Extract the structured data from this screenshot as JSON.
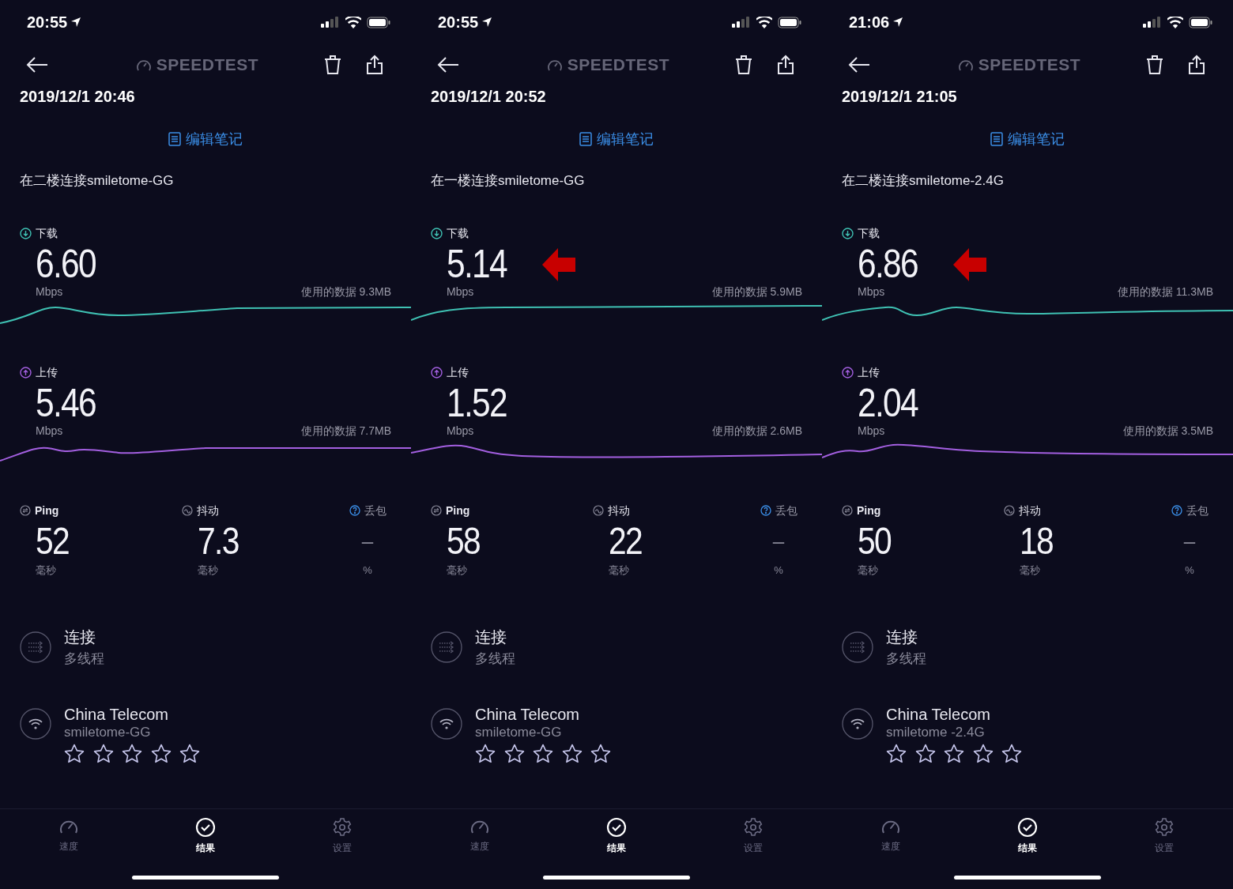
{
  "phones": [
    {
      "status_bar": {
        "time": "20:55"
      },
      "header": {
        "logo": "SPEEDTEST"
      },
      "date": "2019/12/1 20:46",
      "edit_note": "编辑笔记",
      "note": "在二楼连接smiletome-GG",
      "download": {
        "label": "下载",
        "value": "6.60",
        "unit": "Mbps",
        "data_used": "使用的数据 9.3MB",
        "highlighted": false
      },
      "upload": {
        "label": "上传",
        "value": "5.46",
        "unit": "Mbps",
        "data_used": "使用的数据 7.7MB"
      },
      "metrics": [
        {
          "kind": "ping",
          "label": "Ping",
          "value": "52",
          "unit": "毫秒"
        },
        {
          "kind": "jitter",
          "label": "抖动",
          "value": "7.3",
          "unit": "毫秒"
        },
        {
          "kind": "loss",
          "label": "丢包",
          "value": "–",
          "unit": "%"
        }
      ],
      "connection": {
        "title": "连接",
        "subtitle": "多线程"
      },
      "provider": {
        "name": "China Telecom",
        "network": "smiletome-GG",
        "stars": 0
      },
      "tabs": [
        {
          "kind": "speed",
          "label": "速度",
          "selected": false
        },
        {
          "kind": "results",
          "label": "结果",
          "selected": true
        },
        {
          "kind": "settings",
          "label": "设置",
          "selected": false
        }
      ]
    },
    {
      "status_bar": {
        "time": "20:55"
      },
      "header": {
        "logo": "SPEEDTEST"
      },
      "date": "2019/12/1 20:52",
      "edit_note": "编辑笔记",
      "note": "在一楼连接smiletome-GG",
      "download": {
        "label": "下载",
        "value": "5.14",
        "unit": "Mbps",
        "data_used": "使用的数据 5.9MB",
        "highlighted": true
      },
      "upload": {
        "label": "上传",
        "value": "1.52",
        "unit": "Mbps",
        "data_used": "使用的数据 2.6MB"
      },
      "metrics": [
        {
          "kind": "ping",
          "label": "Ping",
          "value": "58",
          "unit": "毫秒"
        },
        {
          "kind": "jitter",
          "label": "抖动",
          "value": "22",
          "unit": "毫秒"
        },
        {
          "kind": "loss",
          "label": "丢包",
          "value": "–",
          "unit": "%"
        }
      ],
      "connection": {
        "title": "连接",
        "subtitle": "多线程"
      },
      "provider": {
        "name": "China Telecom",
        "network": "smiletome-GG",
        "stars": 0
      },
      "tabs": [
        {
          "kind": "speed",
          "label": "速度",
          "selected": false
        },
        {
          "kind": "results",
          "label": "结果",
          "selected": true
        },
        {
          "kind": "settings",
          "label": "设置",
          "selected": false
        }
      ]
    },
    {
      "status_bar": {
        "time": "21:06"
      },
      "header": {
        "logo": "SPEEDTEST"
      },
      "date": "2019/12/1 21:05",
      "edit_note": "编辑笔记",
      "note": "在二楼连接smiletome-2.4G",
      "download": {
        "label": "下载",
        "value": "6.86",
        "unit": "Mbps",
        "data_used": "使用的数据 11.3MB",
        "highlighted": true
      },
      "upload": {
        "label": "上传",
        "value": "2.04",
        "unit": "Mbps",
        "data_used": "使用的数据 3.5MB"
      },
      "metrics": [
        {
          "kind": "ping",
          "label": "Ping",
          "value": "50",
          "unit": "毫秒"
        },
        {
          "kind": "jitter",
          "label": "抖动",
          "value": "18",
          "unit": "毫秒"
        },
        {
          "kind": "loss",
          "label": "丢包",
          "value": "–",
          "unit": "%"
        }
      ],
      "connection": {
        "title": "连接",
        "subtitle": "多线程"
      },
      "provider": {
        "name": "China Telecom",
        "network": "smiletome -2.4G",
        "stars": 0
      },
      "tabs": [
        {
          "kind": "speed",
          "label": "速度",
          "selected": false
        },
        {
          "kind": "results",
          "label": "结果",
          "selected": true
        },
        {
          "kind": "settings",
          "label": "设置",
          "selected": false
        }
      ]
    }
  ]
}
